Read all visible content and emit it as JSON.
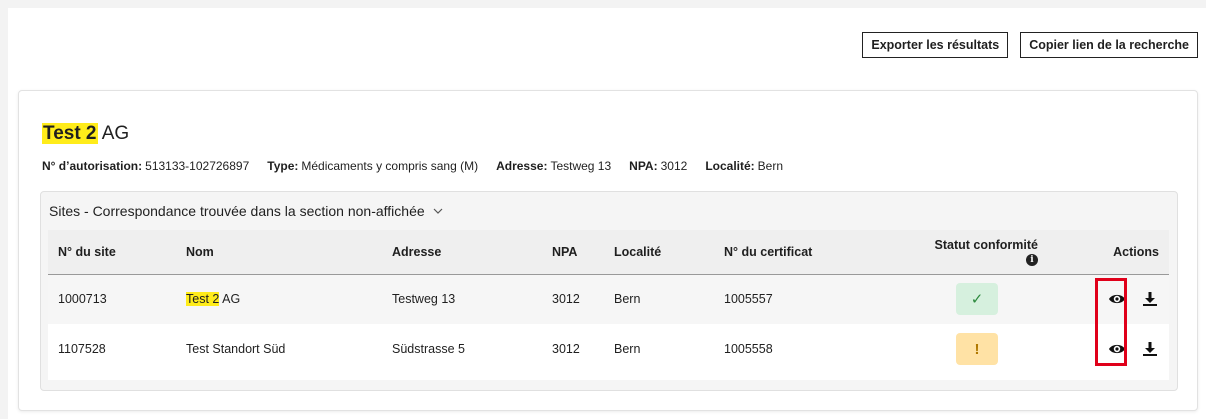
{
  "toolbar": {
    "export_label": "Exporter les résultats",
    "copy_link_label": "Copier lien de la recherche"
  },
  "company": {
    "name_highlight": "Test 2",
    "name_rest": " AG",
    "auth_key": "N° d’autorisation:",
    "auth_val": "513133-102726897",
    "type_key": "Type:",
    "type_val": "Médicaments y compris sang (M)",
    "addr_key": "Adresse:",
    "addr_val": "Testweg 13",
    "npa_key": "NPA:",
    "npa_val": "3012",
    "loc_key": "Localité:",
    "loc_val": "Bern"
  },
  "sites": {
    "header": "Sites - Correspondance trouvée dans la section non-affichée",
    "columns": [
      "N° du site",
      "Nom",
      "Adresse",
      "NPA",
      "Localité",
      "N° du certificat",
      "Statut conformité",
      "Actions"
    ],
    "rows": [
      {
        "site": "1000713",
        "name_highlight": "Test 2",
        "name_rest": " AG",
        "address": "Testweg 13",
        "npa": "3012",
        "locality": "Bern",
        "certificate": "1005557",
        "status": "✓",
        "status_kind": "ok"
      },
      {
        "site": "1107528",
        "name_highlight": "",
        "name_rest": "Test Standort Süd",
        "address": "Südstrasse 5",
        "npa": "3012",
        "locality": "Bern",
        "certificate": "1005558",
        "status": "!",
        "status_kind": "warn"
      }
    ]
  },
  "colors": {
    "highlight": "#ffec1a",
    "annotation": "#e0001a",
    "status_ok_bg": "#d6f0de",
    "status_warn_bg": "#ffe2a5"
  },
  "icons": {
    "view": "eye-icon",
    "download": "download-icon",
    "info": "info-icon",
    "expand": "chevron-down-icon"
  }
}
